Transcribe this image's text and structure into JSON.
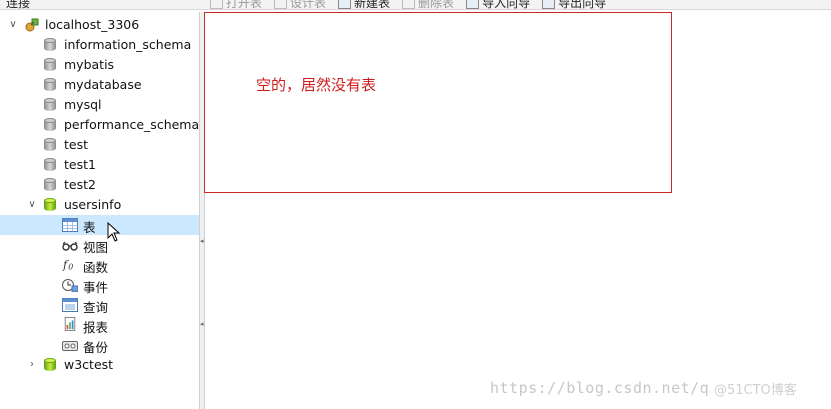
{
  "header": {
    "title": "连接"
  },
  "toolbar": {
    "items": [
      {
        "label": "打开表",
        "enabled": false
      },
      {
        "label": "设计表",
        "enabled": false
      },
      {
        "label": "新建表",
        "enabled": true
      },
      {
        "label": "删除表",
        "enabled": false
      },
      {
        "label": "导入向导",
        "enabled": true
      },
      {
        "label": "导出向导",
        "enabled": true
      }
    ]
  },
  "tree": {
    "connection": "localhost_3306",
    "databases": [
      "information_schema",
      "mybatis",
      "mydatabase",
      "mysql",
      "performance_schema",
      "test",
      "test1",
      "test2"
    ],
    "open_db": "usersinfo",
    "open_db_children": [
      {
        "label": "表",
        "icon": "table-icon",
        "selected": true
      },
      {
        "label": "视图",
        "icon": "view-icon"
      },
      {
        "label": "函数",
        "icon": "function-icon"
      },
      {
        "label": "事件",
        "icon": "event-icon"
      },
      {
        "label": "查询",
        "icon": "query-icon"
      },
      {
        "label": "报表",
        "icon": "report-icon"
      },
      {
        "label": "备份",
        "icon": "backup-icon"
      }
    ],
    "last_db": "w3ctest"
  },
  "annotation": {
    "text": "空的，居然没有表",
    "color": "#d01c1c"
  },
  "watermark": {
    "url": "https://blog.csdn.net/q",
    "badge": "@51CTO博客"
  },
  "colors": {
    "selection": "#cce8ff",
    "db_green": "#8cc63f",
    "db_grey": "#a0a0a0"
  }
}
